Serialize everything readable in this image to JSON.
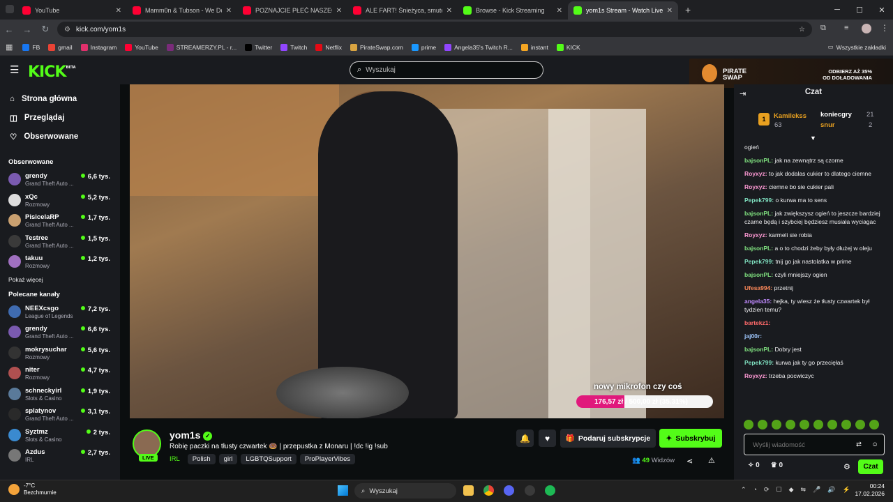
{
  "browser": {
    "tabs": [
      {
        "title": "YouTube",
        "color": "#ff0033",
        "active": false
      },
      {
        "title": "Mamm0n & Tubson - We Don'",
        "color": "#ff0033",
        "active": false
      },
      {
        "title": "POZNAJCIE PŁEĆ NASZEGO DZ",
        "color": "#ff0033",
        "active": false
      },
      {
        "title": "ALE FART! Śnieżyca, smutek Ni",
        "color": "#ff0033",
        "active": false
      },
      {
        "title": "Browse - Kick Streaming",
        "color": "#53fc18",
        "active": false
      },
      {
        "title": "yom1s Stream - Watch Live",
        "color": "#53fc18",
        "active": true
      }
    ],
    "url": "kick.com/yom1s",
    "bookmarks": [
      {
        "label": "FB",
        "color": "#1877f2"
      },
      {
        "label": "gmail",
        "color": "#ea4335"
      },
      {
        "label": "Instagram",
        "color": "#e1306c"
      },
      {
        "label": "YouTube",
        "color": "#ff0033"
      },
      {
        "label": "STREAMERZY.PL - r...",
        "color": "#7a2b7a"
      },
      {
        "label": "Twitter",
        "color": "#000000"
      },
      {
        "label": "Twitch",
        "color": "#9146ff"
      },
      {
        "label": "Netflix",
        "color": "#e50914"
      },
      {
        "label": "PirateSwap.com",
        "color": "#d9a441"
      },
      {
        "label": "prime",
        "color": "#1a98ff"
      },
      {
        "label": "Angela35's Twitch R...",
        "color": "#9146ff"
      },
      {
        "label": "instant",
        "color": "#f5a623"
      },
      {
        "label": "KICK",
        "color": "#53fc18"
      }
    ],
    "all_bookmarks": "Wszystkie zakładki"
  },
  "header": {
    "logo": "KICK",
    "logo_sup": "BETA",
    "search_placeholder": "Wyszukaj",
    "ad_brand": "PIRATE SWAP",
    "ad_text_1": "ODBIERZ AŻ 35%",
    "ad_text_2": "OD DOŁADOWANIA"
  },
  "sidebar": {
    "nav": [
      {
        "label": "Strona główna",
        "icon": "home-icon"
      },
      {
        "label": "Przeglądaj",
        "icon": "browse-icon"
      },
      {
        "label": "Obserwowane",
        "icon": "heart-icon"
      }
    ],
    "followed_title": "Obserwowane",
    "followed": [
      {
        "name": "grendy",
        "game": "Grand Theft Auto ...",
        "viewers": "6,6 tys.",
        "color": "#7a5ab0"
      },
      {
        "name": "xQc",
        "game": "Rozmowy",
        "viewers": "5,2 tys.",
        "color": "#dddddd"
      },
      {
        "name": "PisicelaRP",
        "game": "Grand Theft Auto ...",
        "viewers": "1,7 tys.",
        "color": "#c9a070"
      },
      {
        "name": "Testree",
        "game": "Grand Theft Auto ...",
        "viewers": "1,5 tys.",
        "color": "#3a3a3a"
      },
      {
        "name": "takuu",
        "game": "Rozmowy",
        "viewers": "1,2 tys.",
        "color": "#a070c0"
      }
    ],
    "show_more": "Pokaż więcej",
    "recommended_title": "Polecane kanały",
    "recommended": [
      {
        "name": "NEEXcsgo",
        "game": "League of Legends",
        "viewers": "7,2 tys.",
        "color": "#3f6bb0"
      },
      {
        "name": "grendy",
        "game": "Grand Theft Auto ...",
        "viewers": "6,6 tys.",
        "color": "#7a5ab0"
      },
      {
        "name": "mokrysuchar",
        "game": "Rozmowy",
        "viewers": "5,6 tys.",
        "color": "#333333"
      },
      {
        "name": "niter",
        "game": "Rozmowy",
        "viewers": "4,7 tys.",
        "color": "#b05050"
      },
      {
        "name": "schneckyirl",
        "game": "Slots & Casino",
        "viewers": "1,9 tys.",
        "color": "#5a7a9a"
      },
      {
        "name": "splatynov",
        "game": "Grand Theft Auto ...",
        "viewers": "3,1 tys.",
        "color": "#2a2a2a"
      },
      {
        "name": "Syztmz",
        "game": "Slots & Casino",
        "viewers": "2 tys.",
        "color": "#3a8ad0"
      },
      {
        "name": "Azdus",
        "game": "IRL",
        "viewers": "2,7 tys.",
        "color": "#777777"
      }
    ]
  },
  "video": {
    "overlay_text": "nowy mikrofon czy coś",
    "goal_text": "176,57 zł / 500,00 zł (35.31%)",
    "goal_progress": 0.3531
  },
  "stream": {
    "channel": "yom1s",
    "live_label": "LIVE",
    "title": "Robię paczki na tłusty czwartek 🍩 | przepustka z Monaru | !dc !ig !sub",
    "category": "IRL",
    "tags": [
      "Polish",
      "girl",
      "LGBTQSupport",
      "ProPlayerVibes"
    ],
    "gift_label": "Podaruj subskrypcje",
    "subscribe_label": "Subskrybuj",
    "viewers_count": "49",
    "viewers_label": "Widzów"
  },
  "chat": {
    "title": "Czat",
    "leaders": [
      {
        "name": "Kamilekss",
        "value": "63",
        "color": "#e8a020"
      },
      {
        "name": "koniecgry",
        "value": "21",
        "color": "#ffffff"
      },
      {
        "name": "snur",
        "value": "2",
        "color": "#e8a020"
      }
    ],
    "messages": [
      {
        "user": "",
        "text": "ogień",
        "color": "#ffffff"
      },
      {
        "user": "bajsonPL:",
        "text": "jak na zewnątrz są czorne",
        "color": "#7fe07f"
      },
      {
        "user": "Royxyz:",
        "text": "to jak dodalas cukier to dlatego ciemne",
        "color": "#ff9ad5"
      },
      {
        "user": "Royxyz:",
        "text": "ciemne bo sie cukier pali",
        "color": "#ff9ad5"
      },
      {
        "user": "Pepek799:",
        "text": "o kurwa ma to sens",
        "color": "#7fe0c0"
      },
      {
        "user": "bajsonPL:",
        "text": "jak zwiększysz ogień to jeszcze bardziej czarne będą i szybciej będziesz musiała wyciagac",
        "color": "#7fe07f"
      },
      {
        "user": "Royxyz:",
        "text": "karmeli sie robia",
        "color": "#ff9ad5"
      },
      {
        "user": "bajsonPL:",
        "text": "a o to chodzi żeby były dłużej w oleju",
        "color": "#7fe07f"
      },
      {
        "user": "Pepek799:",
        "text": "tnij go jak nastolatka w prime",
        "color": "#7fe0c0"
      },
      {
        "user": "bajsonPL:",
        "text": "czyli mniejszy ogien",
        "color": "#7fe07f"
      },
      {
        "user": "Ufesa994:",
        "text": "przetnij",
        "color": "#ff8a5a"
      },
      {
        "user": "angela35:",
        "text": "hejka, ty wiesz że tłusty czwartek był tydzien temu?",
        "color": "#c08aff"
      },
      {
        "user": "bartekz1:",
        "text": "",
        "color": "#ff6a6a"
      },
      {
        "user": "jaj00r:",
        "text": "",
        "color": "#a0c8ff"
      },
      {
        "user": "bajsonPL:",
        "text": "Dobry jest",
        "color": "#7fe07f"
      },
      {
        "user": "Pepek799:",
        "text": "kurwa jak ty go przecięłaś",
        "color": "#7fe0c0"
      },
      {
        "user": "Royxyz:",
        "text": "trzeba pocwiczyc",
        "color": "#ff9ad5"
      }
    ],
    "input_placeholder": "Wyślij wiadomość",
    "points": "0",
    "items": "0",
    "send_label": "Czat"
  },
  "taskbar": {
    "weather_temp": "-7°C",
    "weather_desc": "Bezchmurnie",
    "search": "Wyszukaj",
    "time": "00:24",
    "date": "17.02.2026"
  }
}
